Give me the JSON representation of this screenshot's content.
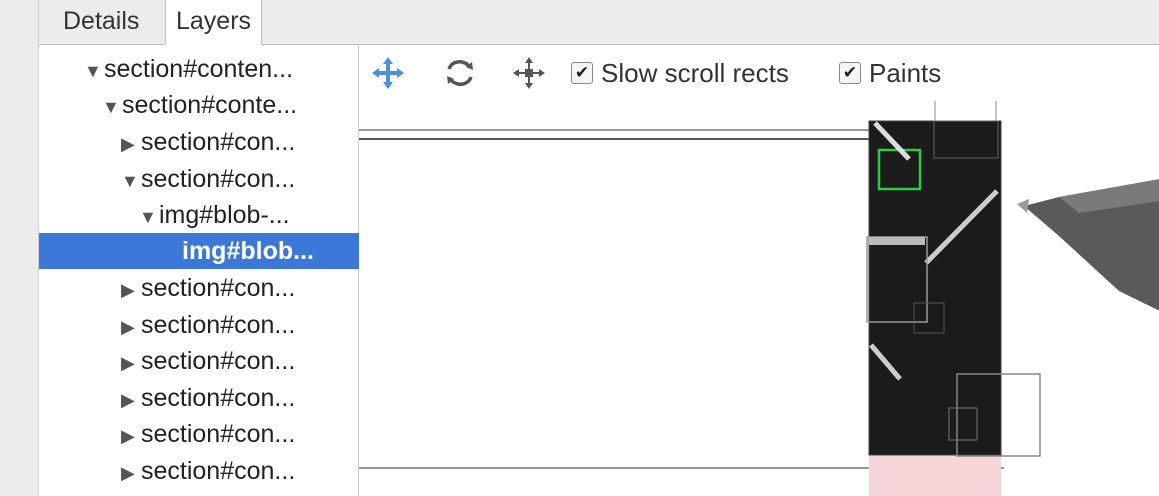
{
  "tabs": [
    {
      "label": "Details"
    },
    {
      "label": "Layers"
    }
  ],
  "tree": {
    "items": [
      {
        "label": "section#conten...",
        "expanded": true
      },
      {
        "label": "section#conte...",
        "expanded": true
      },
      {
        "label": "section#con...",
        "expanded": false
      },
      {
        "label": "section#con...",
        "expanded": true
      },
      {
        "label": "img#blob-...",
        "expanded": true
      },
      {
        "label": "img#blob...",
        "selected": true
      },
      {
        "label": "section#con...",
        "expanded": false
      },
      {
        "label": "section#con...",
        "expanded": false
      },
      {
        "label": "section#con...",
        "expanded": false
      },
      {
        "label": "section#con...",
        "expanded": false
      },
      {
        "label": "section#con...",
        "expanded": false
      },
      {
        "label": "section#con...",
        "expanded": false
      }
    ]
  },
  "toolbar": {
    "pan_icon": "pan-icon",
    "rotate_icon": "rotate-icon",
    "reset_icon": "reset-transform-icon",
    "slow_scroll_label": "Slow scroll rects",
    "slow_scroll_checked": true,
    "paints_label": "Paints",
    "paints_checked": true
  },
  "colors": {
    "selection": "#3c78d8",
    "pan_icon": "#4a8fe0",
    "layer_fill": "#1b1b1b",
    "highlight": "#2ecc40",
    "pink_layer": "#f6d5d8"
  }
}
